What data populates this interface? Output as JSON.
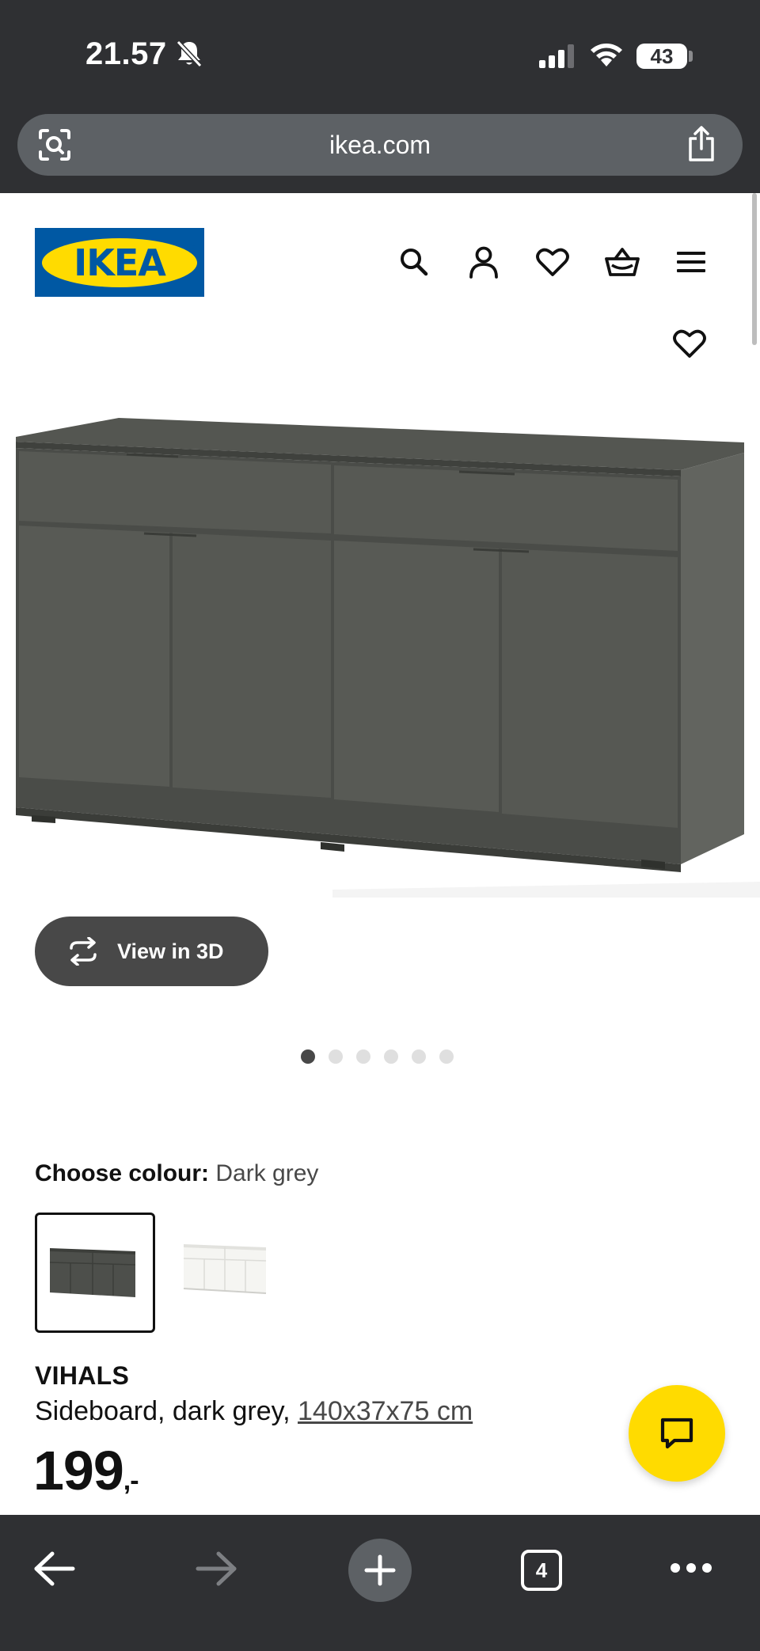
{
  "status_bar": {
    "time": "21.57",
    "battery": "43",
    "battery_level": 0.43
  },
  "browser": {
    "url": "ikea.com",
    "open_tabs": "4"
  },
  "header": {
    "logo_text": "IKEA",
    "logo_colors": {
      "blue": "#0058a3",
      "yellow": "#ffdb00"
    },
    "icons": [
      "search-icon",
      "account-icon",
      "heart-icon",
      "basket-icon",
      "menu-icon"
    ]
  },
  "gallery": {
    "view_3d_label": "View in 3D",
    "image_count": 6,
    "active_index": 0
  },
  "colour": {
    "label": "Choose colour:",
    "value": "Dark grey",
    "options": [
      {
        "name": "Dark grey",
        "color": "#5a5c58",
        "selected": true
      },
      {
        "name": "White",
        "color": "#f4f4f0",
        "selected": false
      }
    ]
  },
  "product": {
    "name": "VIHALS",
    "description": "Sideboard, dark grey,",
    "size": "140x37x75 cm",
    "price": "199",
    "price_suffix": ",-"
  },
  "colors": {
    "chrome_dark": "#2f3033",
    "chat_button": "#ffdb00",
    "pill_button": "#484848"
  }
}
